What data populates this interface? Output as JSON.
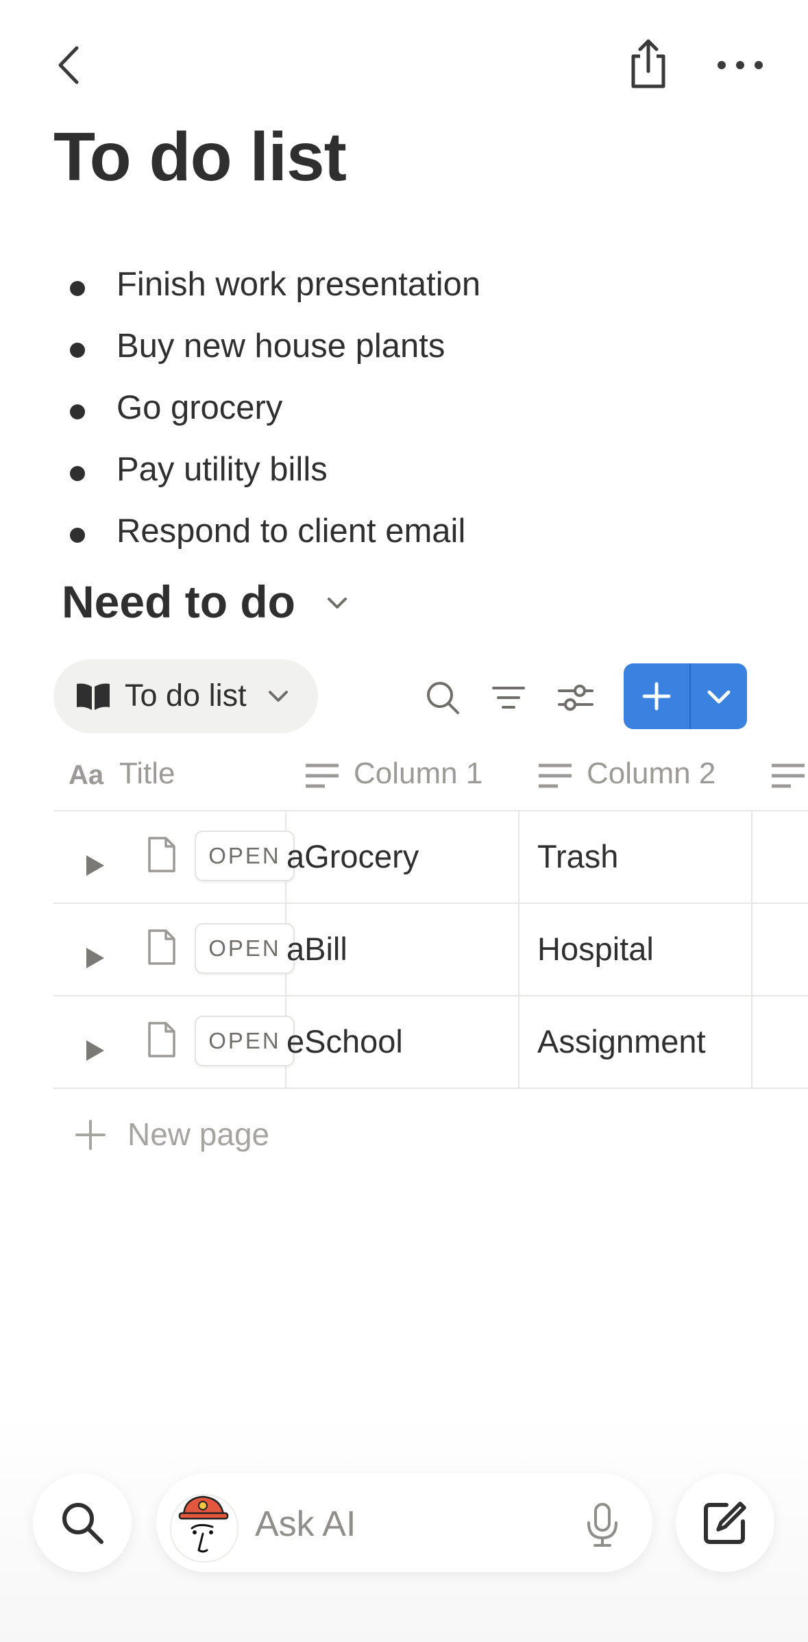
{
  "page": {
    "title": "To do list"
  },
  "bullets": [
    "Finish work presentation",
    "Buy new house plants",
    "Go grocery",
    "Pay utility bills",
    "Respond to client email"
  ],
  "database": {
    "heading": "Need to do",
    "view_label": "To do list",
    "columns": [
      "Title",
      "Column 1",
      "Column 2"
    ],
    "rows": [
      {
        "title": "",
        "open": "OPEN",
        "col1": "aGrocery",
        "col2": "Trash"
      },
      {
        "title": "",
        "open": "OPEN",
        "col1": "aBill",
        "col2": "Hospital"
      },
      {
        "title": "",
        "open": "OPEN",
        "col1": "eSchool",
        "col2": "Assignment"
      }
    ],
    "new_page_label": "New page"
  },
  "bottom_bar": {
    "ask_placeholder": "Ask AI"
  },
  "colors": {
    "accent": "#3b82e0",
    "text": "#2f2f2f",
    "muted": "#9b9a97"
  },
  "icons": [
    "back-chevron-icon",
    "share-icon",
    "more-icon",
    "book-icon",
    "search-icon",
    "filter-icon",
    "settings-sliders-icon",
    "plus-icon",
    "chevron-down-icon",
    "caret-right-icon",
    "document-icon",
    "microphone-icon",
    "compose-icon"
  ]
}
